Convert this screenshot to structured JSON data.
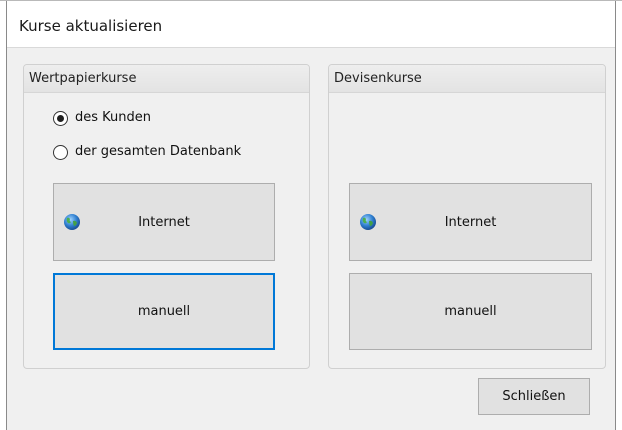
{
  "window": {
    "title": "Kurse aktualisieren"
  },
  "wertpapier": {
    "header": "Wertpapierkurse",
    "radios": [
      {
        "label": "des Kunden",
        "checked": true
      },
      {
        "label": "der gesamten Datenbank",
        "checked": false
      }
    ],
    "internet_label": "Internet",
    "internet_icon": "globe-icon",
    "manual_label": "manuell"
  },
  "devisen": {
    "header": "Devisenkurse",
    "internet_label": "Internet",
    "internet_icon": "globe-icon",
    "manual_label": "manuell"
  },
  "footer": {
    "close_label": "Schließen"
  },
  "colors": {
    "focus_border": "#0078d7",
    "button_face": "#e1e1e1",
    "dialog_bg": "#f0f0f0"
  }
}
